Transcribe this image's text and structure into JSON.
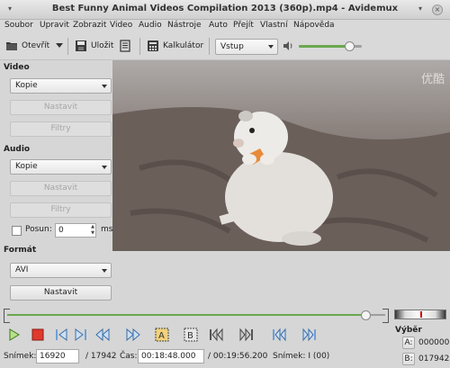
{
  "window": {
    "title": "Best Funny Animal Videos Compilation 2013 (360p).mp4 - Avidemux"
  },
  "menu": [
    "Soubor",
    "Upravit",
    "Zobrazit",
    "Video",
    "Audio",
    "Nástroje",
    "Auto",
    "Přejít",
    "Vlastní",
    "Nápověda"
  ],
  "toolbar": {
    "open_label": "Otevřít",
    "save_label": "Uložit",
    "calc_label": "Kalkulátor",
    "input_mode": "Vstup",
    "volume": 0.86
  },
  "video_section": {
    "title": "Video",
    "codec": "Kopie",
    "configure": "Nastavit",
    "filters": "Filtry"
  },
  "audio_section": {
    "title": "Audio",
    "codec": "Kopie",
    "configure": "Nastavit",
    "filters": "Filtry",
    "shift_label": "Posun:",
    "shift_value": "0",
    "shift_unit": "ms"
  },
  "format_section": {
    "title": "Formát",
    "container": "AVI",
    "configure": "Nastavit"
  },
  "video_overlay": {
    "watermark": "优酷"
  },
  "timeline": {
    "position": 0.96
  },
  "status": {
    "frame_label": "Snímek:",
    "frame_value": "16920",
    "frame_total": "/ 17942",
    "time_label": "Čas:",
    "time_value": "00:18:48.000",
    "duration": "/ 00:19:56.200",
    "frame_type": "Snímek: I (00)"
  },
  "selection": {
    "title": "Výběr",
    "a_label": "A:",
    "a_value": "000000",
    "b_label": "B:",
    "b_value": "017942"
  }
}
